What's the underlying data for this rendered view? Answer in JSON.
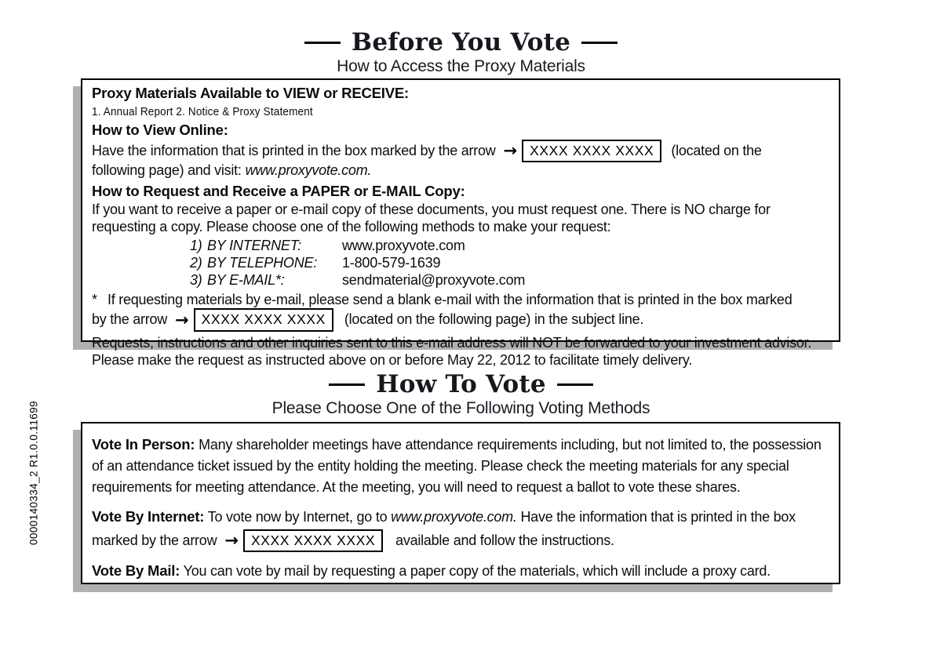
{
  "side_code": "0000140334_2    R1.0.0.11699",
  "section1": {
    "title": "Before You Vote",
    "subtitle": "How to Access the Proxy Materials",
    "available_heading": "Proxy Materials Available to VIEW or RECEIVE:",
    "materials_list": "1. Annual Report    2. Notice & Proxy Statement",
    "view_online_heading": "How to View Online:",
    "view_online_text_1": "Have the information that is printed in the box marked by the arrow",
    "control_number": "XXXX XXXX XXXX",
    "view_online_text_2": "(located on the",
    "view_online_text_3": "following page) and visit:",
    "view_online_site": "www.proxyvote.com.",
    "request_heading": "How to Request and Receive a PAPER or E-MAIL Copy:",
    "request_text": "If you want to receive a paper or e-mail copy of these documents, you must request one.  There is NO charge for requesting a copy.  Please choose one of the following methods to make your request:",
    "methods": [
      {
        "num": "1)",
        "label": "BY INTERNET:",
        "value": "www.proxyvote.com"
      },
      {
        "num": "2)",
        "label": "BY TELEPHONE:",
        "value": "1-800-579-1639"
      },
      {
        "num": "3)",
        "label": "BY E-MAIL*:",
        "value": "sendmaterial@proxyvote.com"
      }
    ],
    "footnote_marker": "*",
    "footnote_text_1": "If requesting materials by e-mail, please send a blank e-mail with the information that is printed in the box marked",
    "footnote_text_2": "by the arrow",
    "footnote_text_3": "(located on the following page) in the subject line.",
    "closing_text": "Requests, instructions and other inquiries sent to this e-mail address will NOT be forwarded to your investment advisor. Please make the request as instructed above on or before May 22, 2012 to facilitate timely delivery."
  },
  "section2": {
    "title": "How To Vote",
    "subtitle": "Please Choose One of the Following Voting Methods",
    "in_person_label": "Vote In Person:",
    "in_person_text": "Many shareholder meetings have attendance requirements including, but not limited to, the possession of an attendance ticket issued by the entity holding the meeting.  Please check the meeting materials for any special requirements for meeting attendance.  At the meeting, you will need to request a ballot to vote these shares.",
    "internet_label": "Vote By Internet:",
    "internet_text_1": "To vote now by Internet, go to",
    "internet_site": "www.proxyvote.com.",
    "internet_text_2": "Have the information that is printed in the box",
    "internet_text_3": "marked by the arrow",
    "control_number": "XXXX XXXX XXXX",
    "internet_text_4": "available and follow the instructions.",
    "mail_label": "Vote By Mail:",
    "mail_text": "You can vote by mail by requesting a paper copy of the materials, which will include a proxy card."
  },
  "icons": {
    "arrow": "→"
  }
}
